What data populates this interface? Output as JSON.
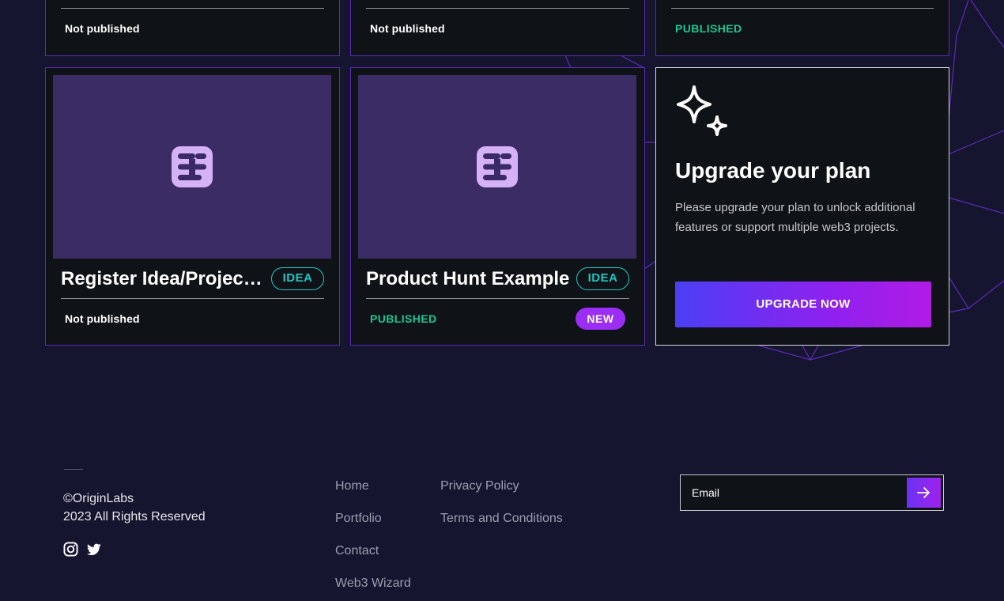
{
  "projects_top_row": [
    {
      "status": "Not published",
      "published": false
    },
    {
      "status": "Not published",
      "published": false
    },
    {
      "status": "PUBLISHED",
      "published": true
    }
  ],
  "projects": [
    {
      "title": "Register Idea/Project…",
      "tag": "IDEA",
      "status": "Not published",
      "published": false,
      "badge": ""
    },
    {
      "title": "Product Hunt Example",
      "tag": "IDEA",
      "status": "PUBLISHED",
      "published": true,
      "badge": "NEW"
    }
  ],
  "upgrade": {
    "title": "Upgrade your plan",
    "text": "Please upgrade your plan to unlock additional features or support multiple web3 projects.",
    "button_label": "UPGRADE NOW",
    "icon": "sparkles-icon"
  },
  "footer": {
    "copyright_line1": "©OriginLabs",
    "copyright_line2": "2023 All Rights Reserved",
    "social": [
      "instagram-icon",
      "twitter-icon"
    ],
    "links_col1": [
      "Home",
      "Portfolio",
      "Contact",
      "Web3 Wizard"
    ],
    "links_col2": [
      "Privacy Policy",
      "Terms and Conditions"
    ],
    "email_placeholder": "Email",
    "submit_icon": "arrow-right-icon"
  },
  "colors": {
    "background": "#16152f",
    "card": "#0f1216",
    "card_border": "#5b2bb3",
    "thumbnail": "#3b2c66",
    "published_green": "#19c793",
    "idea_teal": "#1dc7c3",
    "new_badge": "#9a2ef5",
    "button_gradient_start": "#4b3ff4",
    "button_gradient_end": "#b11be5"
  }
}
